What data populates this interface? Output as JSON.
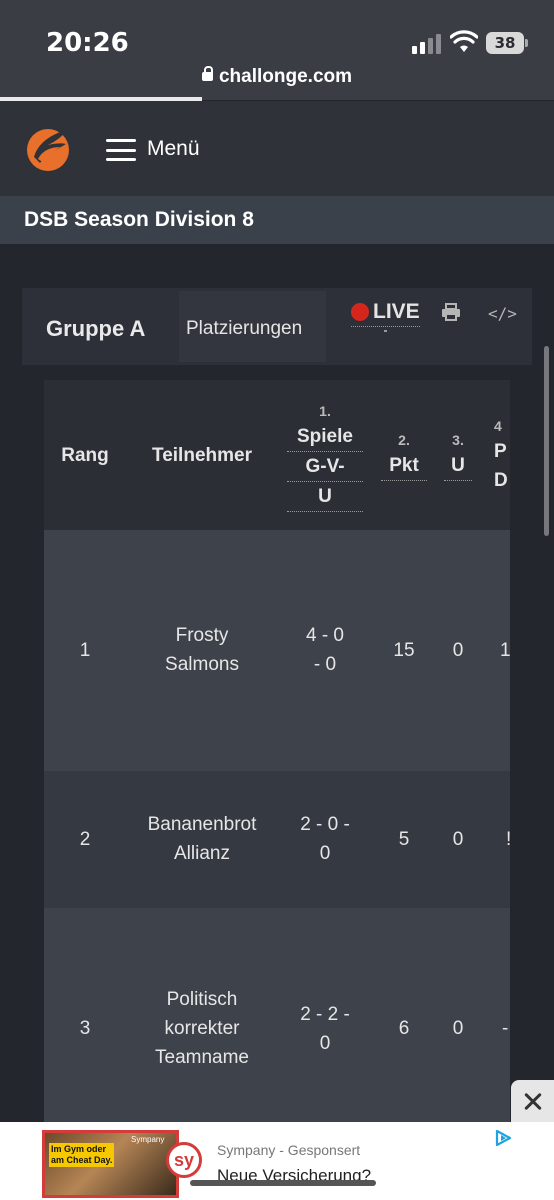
{
  "status_bar": {
    "time": "20:26",
    "battery": "38",
    "url": "challonge.com"
  },
  "header": {
    "logo_icon": "challonge-logo-icon",
    "menu_label": "Menü"
  },
  "page": {
    "title": "DSB Season Division 8"
  },
  "group": {
    "name": "Gruppe A",
    "tab_label": "Platzierungen",
    "live_label": "LIVE",
    "live_color": "#d4261c"
  },
  "table": {
    "columns": {
      "rank": "Rang",
      "participant": "Teilnehmer",
      "games_num": "1.",
      "games_line1": "Spiele",
      "games_line2": "G-V-",
      "games_line3": "U",
      "points_num": "2.",
      "points": "Pkt",
      "draws_num": "3.",
      "draws": "U",
      "col4_num": "4",
      "col4_line1": "P",
      "col4_line2": "D"
    },
    "rows": [
      {
        "rank": "1",
        "name_line1": "Frosty",
        "name_line2": "Salmons",
        "record_line1": "4 - 0",
        "record_line2": "- 0",
        "points": "15",
        "draws": "0",
        "col4": "1"
      },
      {
        "rank": "2",
        "name_line1": "Bananenbrot",
        "name_line2": "Allianz",
        "record_line1": "2 - 0 -",
        "record_line2": "0",
        "points": "5",
        "draws": "0",
        "col4": "!"
      },
      {
        "rank": "3",
        "name_line1": "Politisch",
        "name_line2": "korrekter",
        "name_line3": "Teamname",
        "record_line1": "2 - 2 -",
        "record_line2": "0",
        "points": "6",
        "draws": "0",
        "col4": "-"
      }
    ]
  },
  "ad": {
    "sponsor": "Sympany - Gesponsert",
    "text": "Neue Versicherung?",
    "image_headline_1": "Im Gym oder",
    "image_headline_2": "am Cheat Day.",
    "image_brand": "Sympany",
    "logo_text": "sy"
  }
}
